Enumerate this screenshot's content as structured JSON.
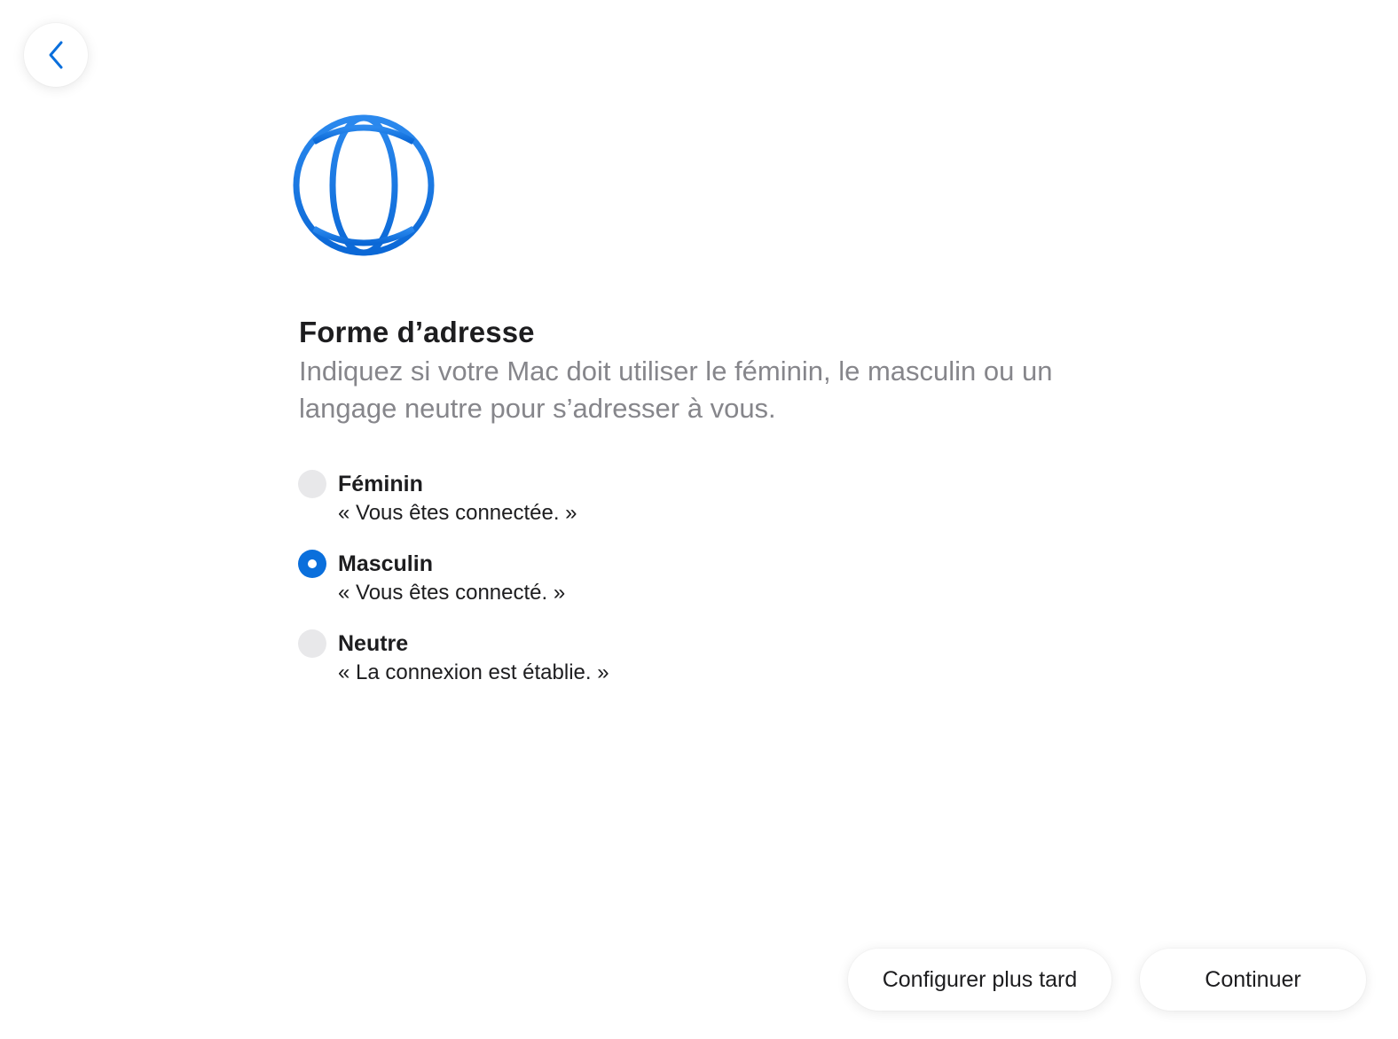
{
  "navigation": {
    "back_icon": "chevron-left-icon"
  },
  "header": {
    "icon": "globe-icon",
    "icon_color": "#1a7ae8",
    "title": "Forme d’adresse",
    "subtitle": "Indiquez si votre Mac doit utiliser le féminin, le masculin ou un langage neutre pour s’adresser à vous."
  },
  "options": [
    {
      "label": "Féminin",
      "example": "« Vous êtes connectée. »",
      "selected": false
    },
    {
      "label": "Masculin",
      "example": "« Vous êtes connecté. »",
      "selected": true
    },
    {
      "label": "Neutre",
      "example": "« La connexion est établie. »",
      "selected": false
    }
  ],
  "footer": {
    "later_label": "Configurer plus tard",
    "continue_label": "Continuer"
  },
  "colors": {
    "accent": "#0a6fdc",
    "title": "#1d1d1f",
    "subtitle": "#86868b",
    "radio_unselected": "#e8e8ea"
  }
}
